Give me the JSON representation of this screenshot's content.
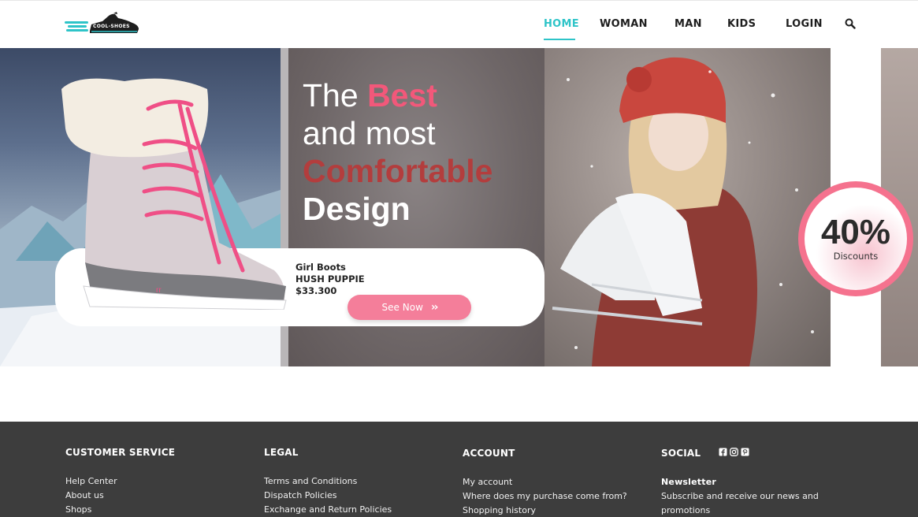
{
  "header": {
    "logo_text": "COOL-SHOES",
    "nav": [
      {
        "label": "HOME",
        "active": true
      },
      {
        "label": "WOMAN"
      },
      {
        "label": "MAN"
      },
      {
        "label": "KIDS"
      },
      {
        "label": "LOGIN"
      }
    ],
    "search_icon": "search-icon"
  },
  "hero": {
    "headline": {
      "line1_prefix": "The",
      "line1_highlight": "Best",
      "line2": "and most",
      "line3": "Comfortable",
      "line4": "Design"
    },
    "product": {
      "category": "Girl Boots",
      "name": "HUSH PUPPIE",
      "price": "$33.300",
      "cta_label": "See Now",
      "cta_icon": "chevrons-right-icon"
    },
    "discount": {
      "value": "40%",
      "label": "Discounts"
    }
  },
  "footer": {
    "customer_service": {
      "title": "CUSTOMER SERVICE",
      "links": [
        "Help Center",
        "About us",
        "Shops"
      ]
    },
    "legal": {
      "title": "LEGAL",
      "links": [
        "Terms and Conditions",
        "Dispatch Policies",
        "Exchange and Return Policies"
      ]
    },
    "account": {
      "title": "ACCOUNT",
      "links": [
        "My account",
        "Where does my purchase come from?",
        "Shopping history"
      ]
    },
    "social": {
      "title": "SOCIAL",
      "icons": [
        "facebook-icon",
        "instagram-icon",
        "pinterest-icon"
      ],
      "newsletter_title": "Newsletter",
      "newsletter_line1": "Subscribe and receive our news and",
      "newsletter_line2": "promotions"
    }
  },
  "colors": {
    "accent": "#2ec4c8",
    "pink": "#f2587a",
    "dark_red": "#b33d3d",
    "footer_bg": "#3d3d3d"
  }
}
